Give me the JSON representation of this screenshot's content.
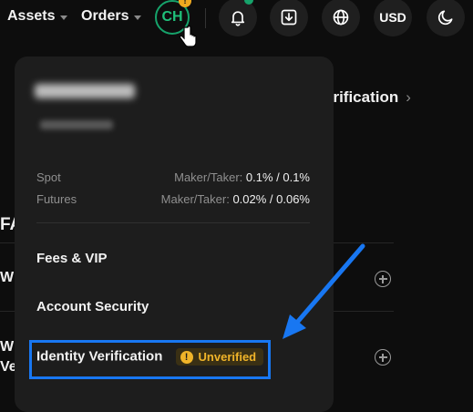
{
  "nav": {
    "assets_label": "Assets",
    "orders_label": "Orders",
    "avatar_initials": "CH",
    "avatar_badge": "!",
    "currency_label": "USD"
  },
  "background": {
    "verification_label": "erification",
    "section_fragment": "FA",
    "row1_fragment": "W",
    "row2_fragment_line1": "W",
    "row2_fragment_line2": "Ve"
  },
  "dropdown": {
    "fees": [
      {
        "label": "Spot",
        "maker_taker_label": "Maker/Taker:",
        "value": "0.1% / 0.1%"
      },
      {
        "label": "Futures",
        "maker_taker_label": "Maker/Taker:",
        "value": "0.02% / 0.06%"
      }
    ],
    "menu": {
      "fees_vip": "Fees & VIP",
      "account_security": "Account Security",
      "identity_verification": "Identity Verification",
      "unverified_badge": "Unverified"
    }
  },
  "colors": {
    "accent_green": "#16a36b",
    "warning": "#f0b429",
    "annotation_blue": "#1877f2"
  }
}
